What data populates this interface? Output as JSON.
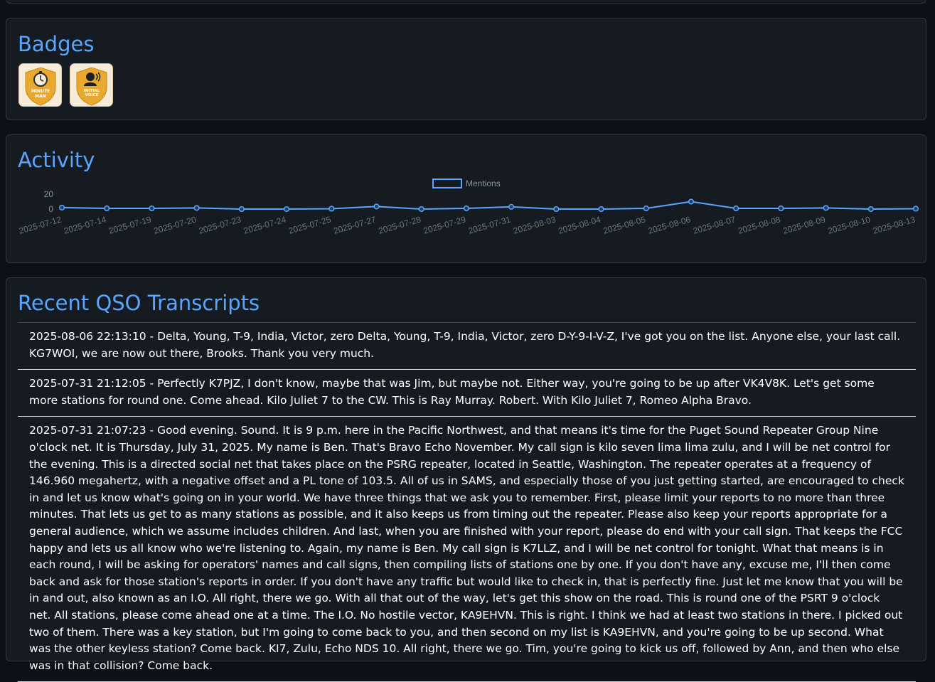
{
  "badges": {
    "title": "Badges",
    "items": [
      {
        "name": "stopwatch-badge-icon",
        "text_line1": "MINUTE",
        "text_line2": "MAN"
      },
      {
        "name": "speaker-badge-icon",
        "text_line1": "INITIAL",
        "text_line2": "VOICE"
      }
    ],
    "colors": {
      "shield": "#e9a92e",
      "background": "#f7ecd8"
    }
  },
  "activity": {
    "title": "Activity",
    "chart_data": {
      "type": "line",
      "series": [
        {
          "name": "Mentions",
          "values": [
            2,
            1,
            1,
            1.5,
            0,
            0,
            0.5,
            3.5,
            0,
            1,
            3,
            0,
            0,
            1,
            10,
            1,
            1,
            1.5,
            0,
            0.5
          ]
        }
      ],
      "categories": [
        "2025-07-12",
        "2025-07-14",
        "2025-07-19",
        "2025-07-20",
        "2025-07-23",
        "2025-07-24",
        "2025-07-25",
        "2025-07-27",
        "2025-07-28",
        "2025-07-29",
        "2025-07-31",
        "2025-08-03",
        "2025-08-04",
        "2025-08-05",
        "2025-08-06",
        "2025-08-07",
        "2025-08-08",
        "2025-08-09",
        "2025-08-10",
        "2025-08-13"
      ],
      "yticks": [
        "20",
        "0"
      ],
      "ylim": [
        0,
        20
      ],
      "legend_position": "top-center",
      "color": "#58a6ff"
    }
  },
  "qso": {
    "title": "Recent QSO Transcripts",
    "items": [
      "2025-08-06 22:13:10 - Delta, Young, T-9, India, Victor, zero Delta, Young, T-9, India, Victor, zero D-Y-9-I-V-Z, I've got you on the list. Anyone else, your last call. KG7WOI, we are now out there, Brooks. Thank you very much.",
      "2025-07-31 21:12:05 - Perfectly K7PJZ, I don't know, maybe that was Jim, but maybe not. Either way, you're going to be up after VK4V8K. Let's get some more stations for round one. Come ahead. Kilo Juliet 7 to the CW. This is Ray Murray. Robert. With Kilo Juliet 7, Romeo Alpha Bravo.",
      "2025-07-31 21:07:23 - Good evening. Sound. It is 9 p.m. here in the Pacific Northwest, and that means it's time for the Puget Sound Repeater Group Nine o'clock net. It is Thursday, July 31, 2025. My name is Ben. That's Bravo Echo November. My call sign is kilo seven lima lima zulu, and I will be net control for the evening. This is a directed social net that takes place on the PSRG repeater, located in Seattle, Washington. The repeater operates at a frequency of 146.960 megahertz, with a negative offset and a PL tone of 103.5. All of us in SAMS, and especially those of you just getting started, are encouraged to check in and let us know what's going on in your world. We have three things that we ask you to remember. First, please limit your reports to no more than three minutes. That lets us get to as many stations as possible, and it also keeps us from timing out the repeater. Please also keep your reports appropriate for a general audience, which we assume includes children. And last, when you are finished with your report, please do end with your call sign. That keeps the FCC happy and lets us all know who we're listening to. Again, my name is Ben. My call sign is K7LLZ, and I will be net control for tonight. What that means is in each round, I will be asking for operators' names and call signs, then compiling lists of stations one by one. If you don't have any, excuse me, I'll then come back and ask for those station's reports in order. If you don't have any traffic but would like to check in, that is perfectly fine. Just let me know that you will be in and out, also known as an I.O. All right, there we go. With all that out of the way, let's get this show on the road. This is round one of the PSRT 9 o'clock net. All stations, please come ahead one at a time. The I.O. No hostile vector, KA9EHVN. This is right. I think we had at least two stations in there. I picked out two of them. There was a key station, but I'm going to come back to you, and then second on my list is KA9EHVN, and you're going to be up second. What was the other keyless station? Come back. KI7, Zulu, Echo NDS 10. All right, there we go. Tim, you're going to kick us off, followed by Ann, and then who else was in that collision? Come back."
    ]
  }
}
